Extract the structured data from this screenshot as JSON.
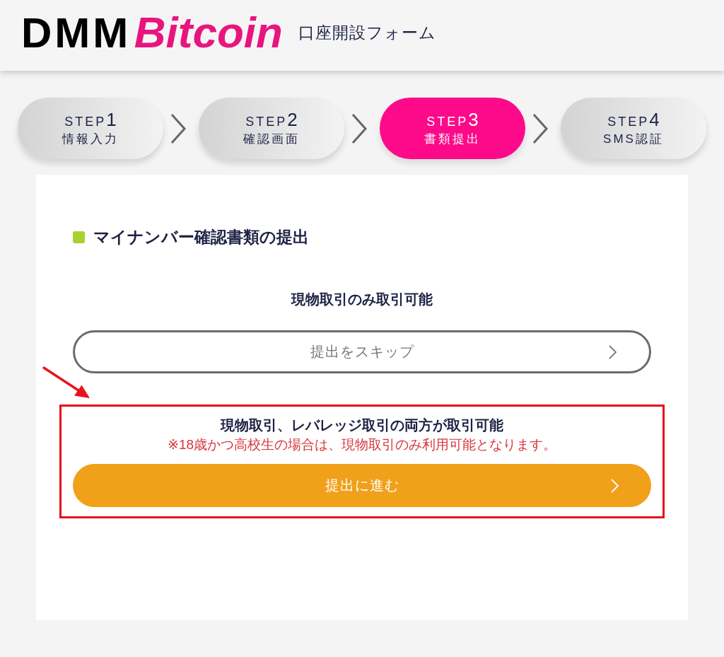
{
  "header": {
    "logo": {
      "primary": "DMM",
      "secondary": "Bitcoin"
    },
    "title": "口座開設フォーム"
  },
  "steps": [
    {
      "label": "STEP",
      "number": "1",
      "name": "情報入力",
      "selected": false
    },
    {
      "label": "STEP",
      "number": "2",
      "name": "確認画面",
      "selected": false
    },
    {
      "label": "STEP",
      "number": "3",
      "name": "書類提出",
      "selected": true
    },
    {
      "label": "STEP",
      "number": "4",
      "name": "SMS認証",
      "selected": false
    }
  ],
  "section": {
    "title": "マイナンバー確認書類の提出",
    "options": [
      {
        "heading": "現物取引のみ取引可能",
        "button": {
          "label": "提出をスキップ",
          "kind": "outline"
        },
        "highlighted": false
      },
      {
        "heading": "現物取引、レバレッジ取引の両方が取引可能",
        "note": "※18歳かつ高校生の場合は、現物取引のみ利用可能となります。",
        "button": {
          "label": "提出に進む",
          "kind": "primary"
        },
        "highlighted": true
      }
    ]
  }
}
